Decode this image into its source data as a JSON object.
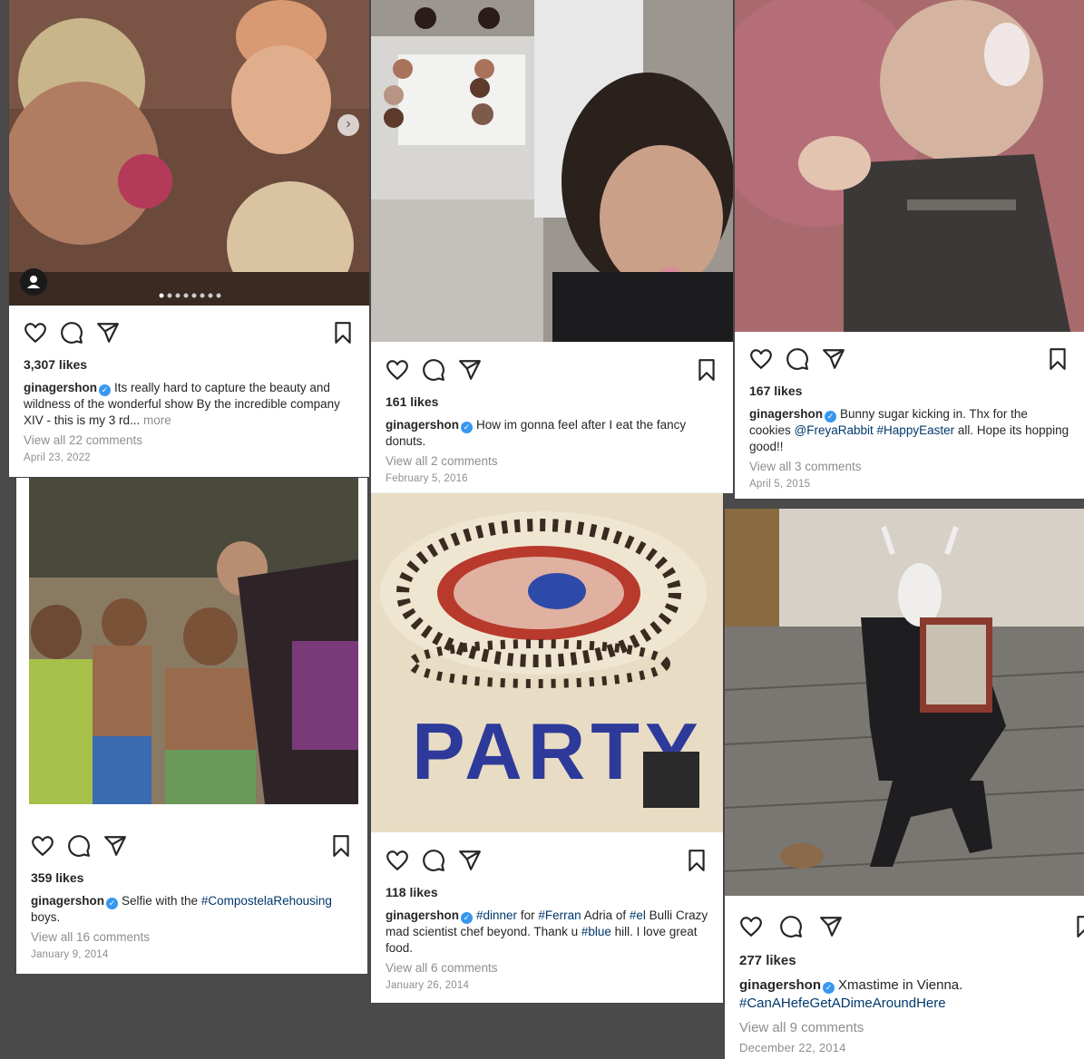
{
  "colors": {
    "background": "#4a4a4a",
    "card": "#ffffff",
    "link": "#00376b",
    "muted": "#8e8e8e",
    "verified": "#3897f0"
  },
  "icons": [
    "heart-icon",
    "comment-icon",
    "share-icon",
    "bookmark-icon",
    "verified-icon",
    "carousel-next-icon",
    "user-tag-icon"
  ],
  "posts": [
    {
      "likes": "3,307 likes",
      "username": "ginagershon",
      "caption_parts": [
        {
          "text": "Its really hard to capture the beauty and wildness of the wonderful show By the incredible company XIV - this is my 3 rd... ",
          "kind": "text"
        },
        {
          "text": "more",
          "kind": "more"
        }
      ],
      "comments": "View all 22 comments",
      "date": "April 23, 2022"
    },
    {
      "likes": "161 likes",
      "username": "ginagershon",
      "caption_parts": [
        {
          "text": "How im gonna feel after I eat the fancy donuts.",
          "kind": "text"
        }
      ],
      "comments": "View all 2 comments",
      "date": "February 5, 2016"
    },
    {
      "likes": "167 likes",
      "username": "ginagershon",
      "caption_parts": [
        {
          "text": "Bunny sugar kicking in. Thx for the cookies ",
          "kind": "text"
        },
        {
          "text": "@FreyaRabbit",
          "kind": "tag"
        },
        {
          "text": " ",
          "kind": "text"
        },
        {
          "text": "#HappyEaster",
          "kind": "tag"
        },
        {
          "text": " all. Hope its hopping good!!",
          "kind": "text"
        }
      ],
      "comments": "View all 3 comments",
      "date": "April 5, 2015"
    },
    {
      "likes": "359 likes",
      "username": "ginagershon",
      "caption_parts": [
        {
          "text": "Selfie with the ",
          "kind": "text"
        },
        {
          "text": "#CompostelaRehousing",
          "kind": "tag"
        },
        {
          "text": " boys.",
          "kind": "text"
        }
      ],
      "comments": "View all 16 comments",
      "date": "January 9, 2014"
    },
    {
      "likes": "118 likes",
      "username": "ginagershon",
      "caption_parts": [
        {
          "text": "#dinner",
          "kind": "tag"
        },
        {
          "text": " for ",
          "kind": "text"
        },
        {
          "text": "#Ferran",
          "kind": "tag"
        },
        {
          "text": " Adria of ",
          "kind": "text"
        },
        {
          "text": "#el",
          "kind": "tag"
        },
        {
          "text": " Bulli Crazy mad scientist chef beyond. Thank u ",
          "kind": "text"
        },
        {
          "text": "#blue",
          "kind": "tag"
        },
        {
          "text": " hill. I love great food.",
          "kind": "text"
        }
      ],
      "comments": "View all 6 comments",
      "date": "January 26, 2014"
    },
    {
      "likes": "277 likes",
      "username": "ginagershon",
      "caption_parts": [
        {
          "text": "Xmastime in Vienna. ",
          "kind": "text"
        },
        {
          "text": "#CanAHefeGetADimeAroundHere",
          "kind": "tag"
        }
      ],
      "comments": "View all 9 comments",
      "date": "December 22, 2014"
    }
  ]
}
